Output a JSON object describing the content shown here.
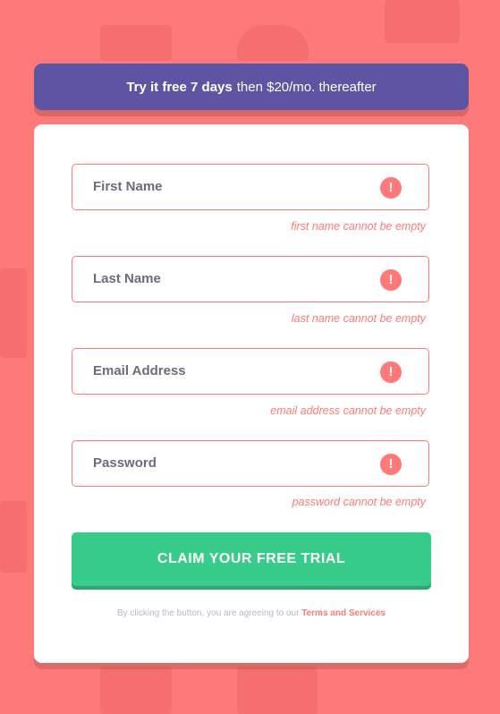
{
  "promo": {
    "bold": "Try it free 7 days",
    "rest": "then $20/mo. thereafter"
  },
  "form": {
    "fields": [
      {
        "placeholder": "First Name",
        "error": "first name cannot be empty",
        "icon": "exclamation-icon"
      },
      {
        "placeholder": "Last Name",
        "error": "last name cannot be empty",
        "icon": "exclamation-icon"
      },
      {
        "placeholder": "Email Address",
        "error": "email address cannot be empty",
        "icon": "exclamation-icon"
      },
      {
        "placeholder": "Password",
        "error": "password cannot be empty",
        "icon": "exclamation-icon"
      }
    ],
    "submit_label": "CLAIM YOUR FREE TRIAL",
    "terms_prefix": "By clicking the button, you are agreeing to our",
    "terms_link": "Terms and Services",
    "error_icon_glyph": "!"
  },
  "colors": {
    "background": "#fe7979",
    "promo": "#5e54a4",
    "accent_green": "#38cc8b",
    "error_red": "#ff7979"
  }
}
